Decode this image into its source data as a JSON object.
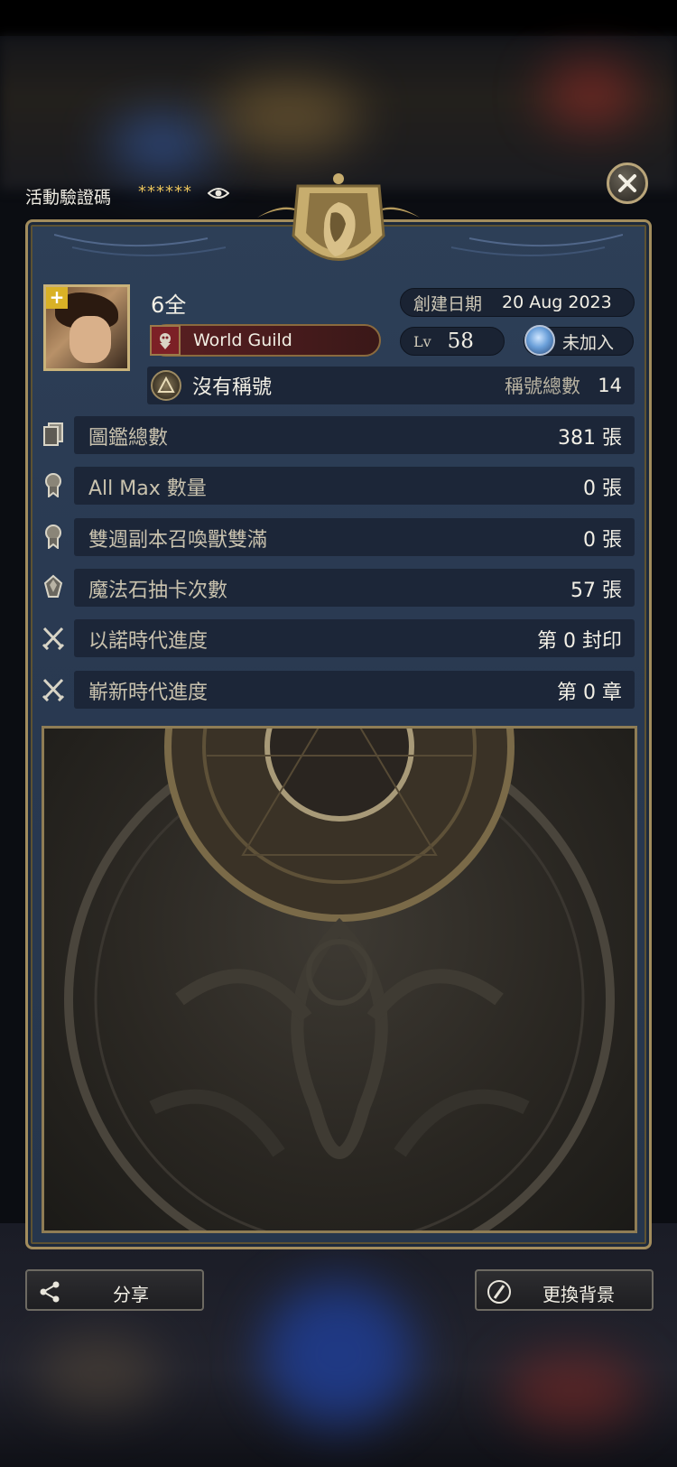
{
  "header": {
    "promo_code_label": "活動驗證碼",
    "promo_code_masked": "******"
  },
  "profile": {
    "name": "6全",
    "created_label": "創建日期",
    "created_date": "20 Aug 2023",
    "guild_name": "World Guild",
    "level_label": "Lv",
    "level": "58",
    "join_status": "未加入",
    "title_name": "沒有稱號",
    "title_count_label": "稱號總數",
    "title_count": "14"
  },
  "stats": [
    {
      "label": "圖鑑總數",
      "value": "381 張",
      "icon": "card-collection-icon"
    },
    {
      "label": "All Max 數量",
      "value": "0 張",
      "icon": "medal-icon"
    },
    {
      "label": "雙週副本召喚獸雙滿",
      "value": "0 張",
      "icon": "medal-icon"
    },
    {
      "label": "魔法石抽卡次數",
      "value": "57 張",
      "icon": "magic-stone-icon"
    },
    {
      "label": "以諾時代進度",
      "value": "第 0 封印",
      "icon": "crossed-swords-icon"
    },
    {
      "label": "嶄新時代進度",
      "value": "第 0 章",
      "icon": "crossed-swords-icon"
    }
  ],
  "buttons": {
    "share": "分享",
    "change_background": "更換背景"
  },
  "colors": {
    "panel": "#2a3a52",
    "gold_border": "#a38d5d",
    "row": "#1c2638"
  }
}
